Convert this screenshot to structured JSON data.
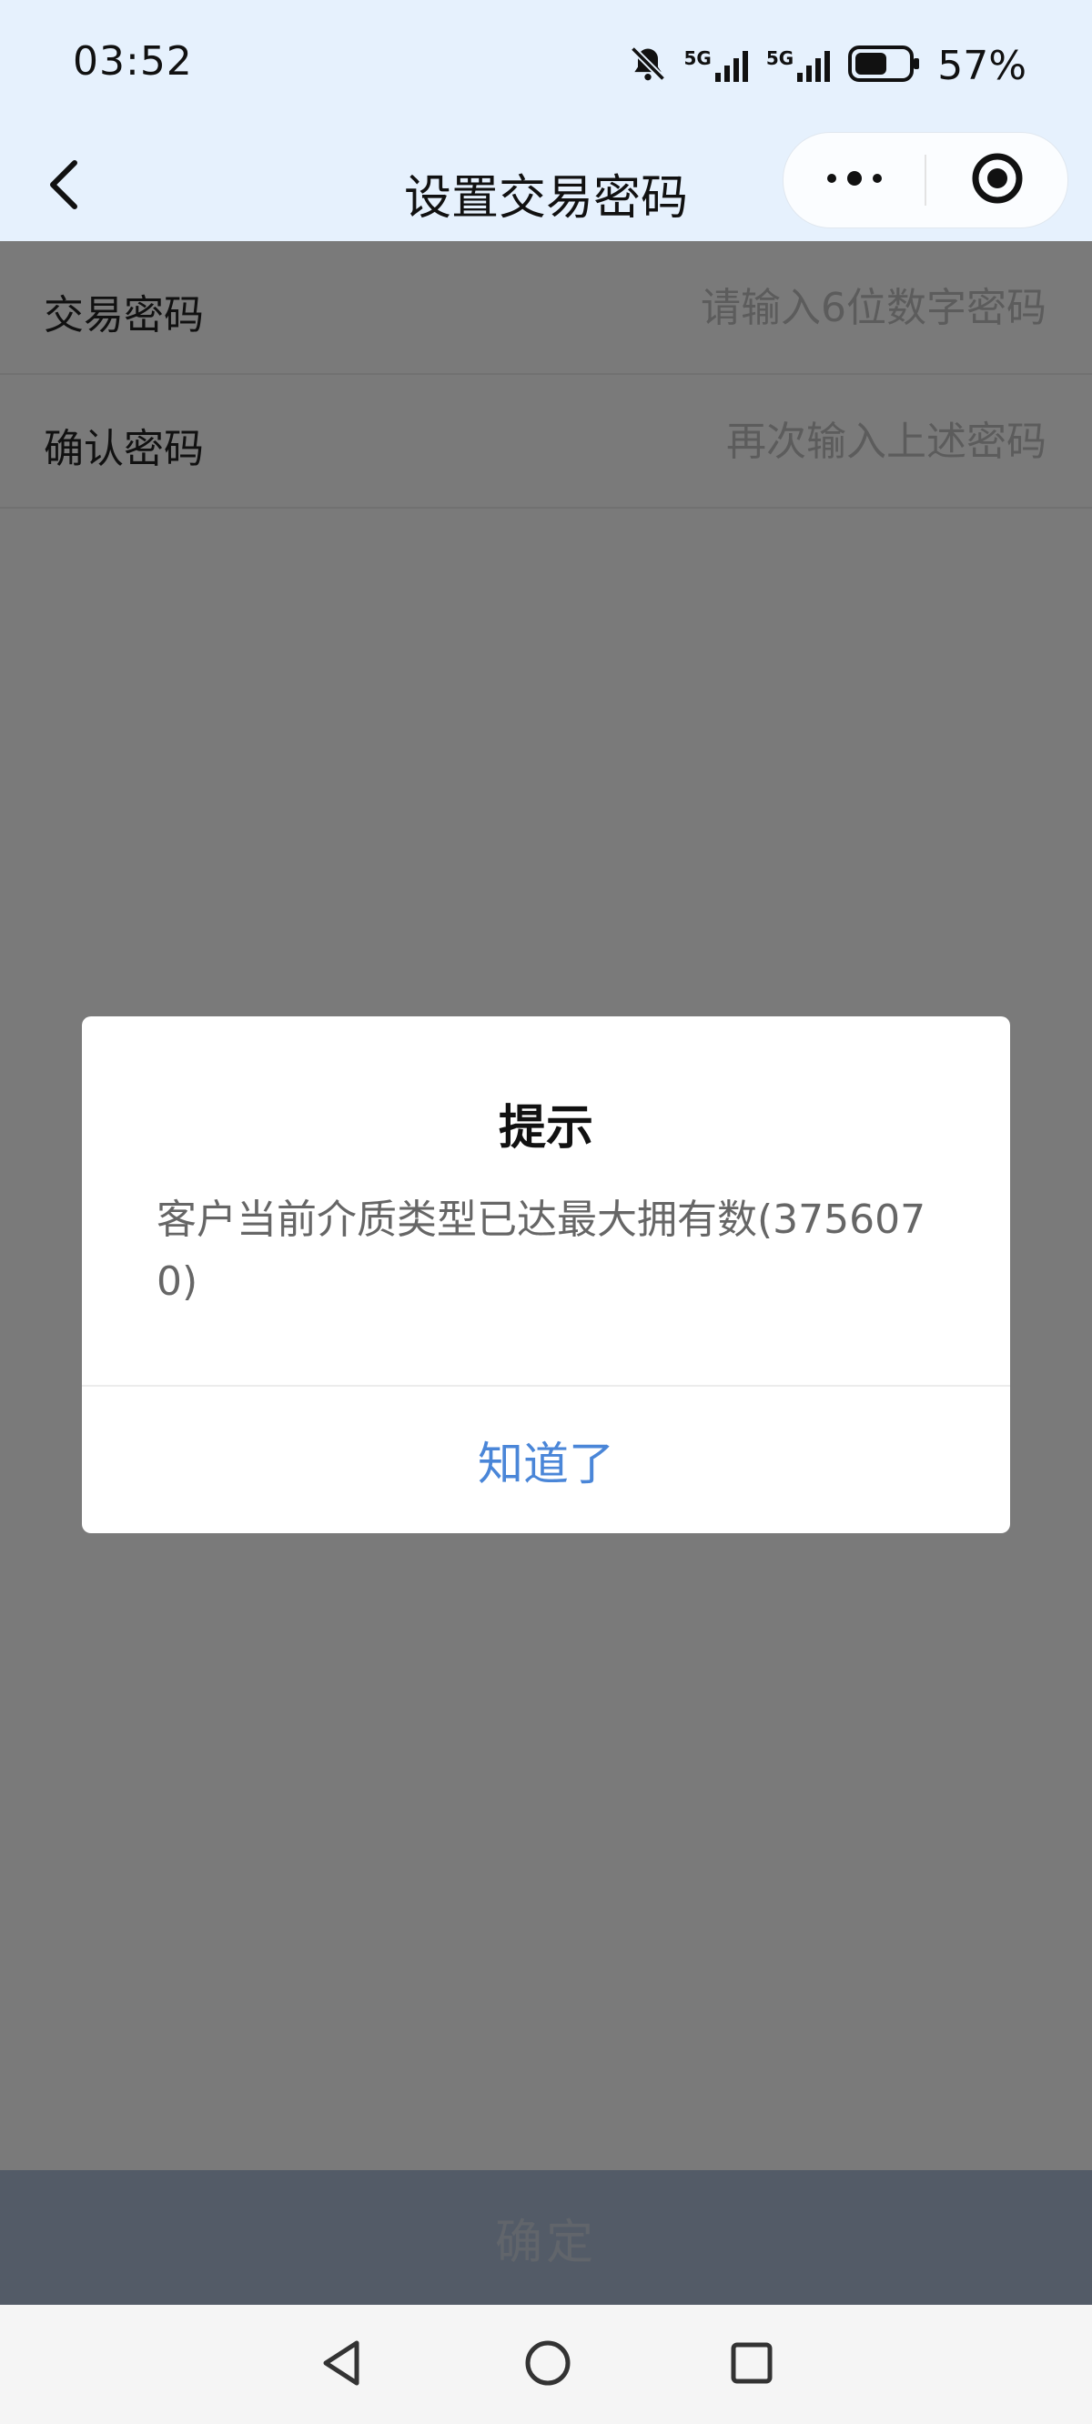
{
  "status_bar": {
    "time": "03:52",
    "signal1_label": "5G",
    "signal2_label": "5G",
    "battery_percent": "57%"
  },
  "nav": {
    "title": "设置交易密码",
    "back_icon": "chevron-left-icon",
    "more_icon": "more-dots-icon",
    "close_icon": "target-close-icon"
  },
  "form": {
    "rows": [
      {
        "label": "交易密码",
        "placeholder": "请输入6位数字密码",
        "value": ""
      },
      {
        "label": "确认密码",
        "placeholder": "再次输入上述密码",
        "value": ""
      }
    ]
  },
  "confirm_button": {
    "label": "确定"
  },
  "dialog": {
    "title": "提示",
    "message": "客户当前介质类型已达最大拥有数(3756070)",
    "button_label": "知道了"
  },
  "colors": {
    "header_bg": "#e6f1fd",
    "dialog_button": "#4a86d8",
    "confirm_bar": "#a6b6ce"
  }
}
